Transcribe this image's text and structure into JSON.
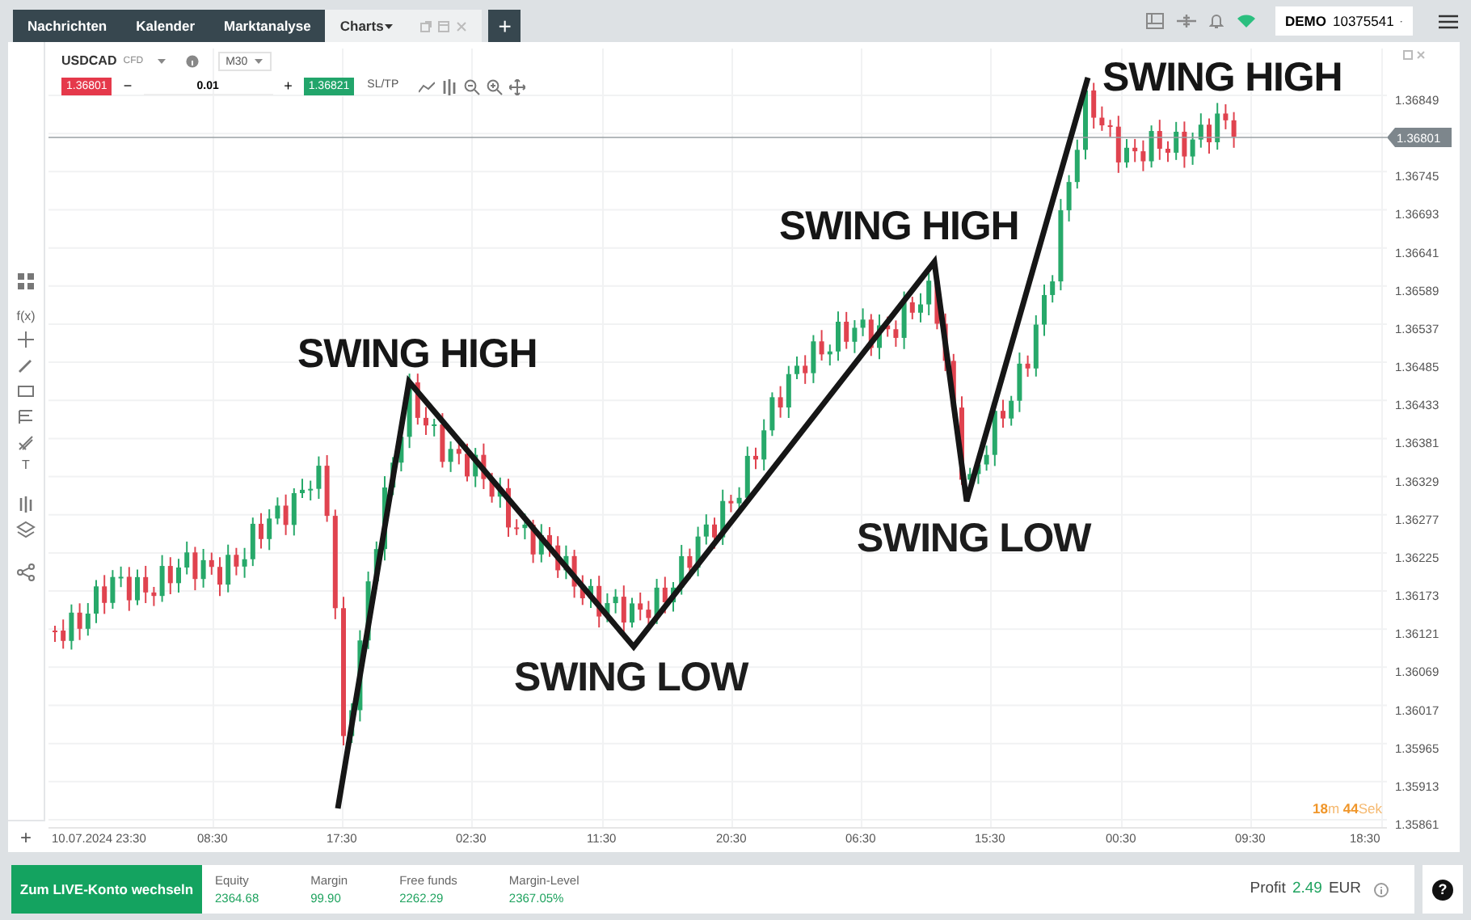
{
  "tabs": [
    {
      "label": "Nachrichten",
      "selected": false
    },
    {
      "label": "Kalender",
      "selected": false
    },
    {
      "label": "Marktanalyse",
      "selected": false
    },
    {
      "label": "Charts",
      "selected": true
    }
  ],
  "new_tab": "+",
  "account": {
    "mode": "DEMO",
    "number": "10375541"
  },
  "left_toolbar": {
    "function_tool": "f(x)",
    "text_tool": "T",
    "add_button": "+"
  },
  "chart": {
    "symbol": "USDCAD",
    "symbol_type": "CFD",
    "timeframe": "M30",
    "sell_price": "1.36801",
    "minus": "−",
    "quantity": "0.01",
    "plus": "+",
    "buy_price": "1.36821",
    "sl_tp": "SL/TP",
    "current_price": "1.36801",
    "price_axis": [
      "1.36849",
      "1.36745",
      "1.36693",
      "1.36641",
      "1.36589",
      "1.36537",
      "1.36485",
      "1.36433",
      "1.36381",
      "1.36329",
      "1.36277",
      "1.36225",
      "1.36173",
      "1.36121",
      "1.36069",
      "1.36017",
      "1.35965",
      "1.35913",
      "1.35861"
    ],
    "time_axis": [
      "10.07.2024 23:30",
      "08:30",
      "17:30",
      "02:30",
      "11:30",
      "20:30",
      "06:30",
      "15:30",
      "00:30",
      "09:30",
      "18:30"
    ],
    "annotations": [
      {
        "label": "SWING HIGH",
        "kind": "high"
      },
      {
        "label": "SWING LOW",
        "kind": "low"
      },
      {
        "label": "SWING HIGH",
        "kind": "high"
      },
      {
        "label": "SWING LOW",
        "kind": "low"
      },
      {
        "label": "SWING HIGH",
        "kind": "high"
      }
    ],
    "countdown": "**18**m **44**Sek"
  },
  "footer": {
    "switch_button": "Zum LIVE-Konto wechseln",
    "stats": [
      {
        "label": "Equity",
        "value": "2364.68"
      },
      {
        "label": "Margin",
        "value": "99.90"
      },
      {
        "label": "Free funds",
        "value": "2262.29"
      },
      {
        "label": "Margin-Level",
        "value": "2367.05%"
      }
    ],
    "profit_label": "Profit",
    "profit_value": "2.49",
    "profit_currency": "EUR",
    "help": "?"
  }
}
